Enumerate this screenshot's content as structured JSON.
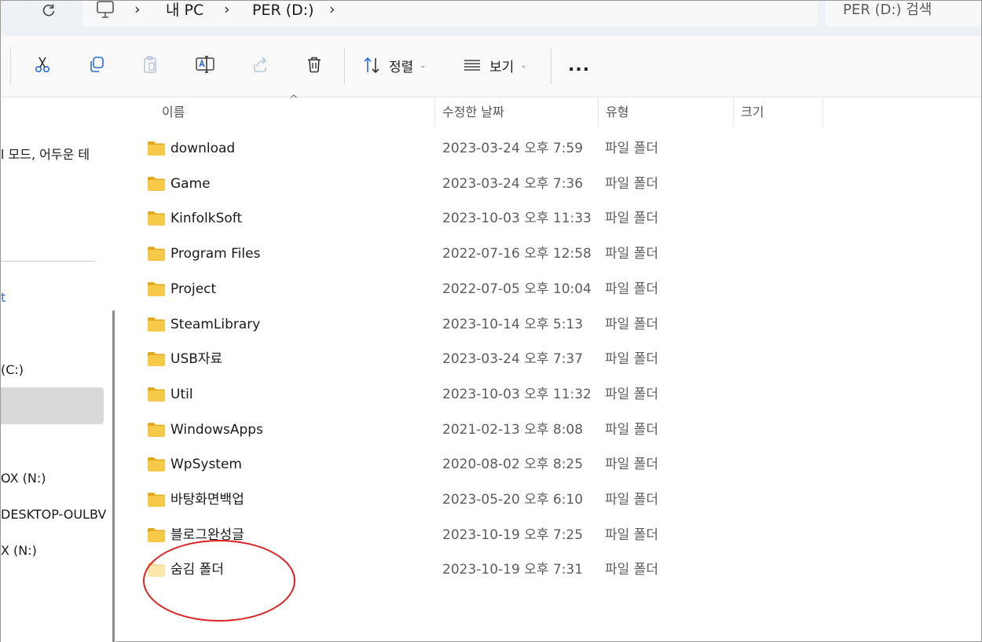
{
  "address": {
    "crumbs": [
      "내 PC",
      "PER (D:)"
    ],
    "search_placeholder": "PER (D:) 검색"
  },
  "toolbar": {
    "sort_label": "정렬",
    "view_label": "보기",
    "more_label": "..."
  },
  "nav": {
    "snippets": [
      {
        "text": "l 모드, 어두운 테"
      },
      {
        "text": "t"
      },
      {
        "text": "(C:)"
      },
      {
        "text": "OX (N:)"
      },
      {
        "text": "DESKTOP-OULBV"
      },
      {
        "text": "X (N:)"
      }
    ]
  },
  "columns": {
    "name": "이름",
    "date": "수정한 날짜",
    "type": "유형",
    "size": "크기"
  },
  "files": [
    {
      "name": "download",
      "date": "2023-03-24 오후 7:59",
      "type": "파일 폴더",
      "hidden": false
    },
    {
      "name": "Game",
      "date": "2023-03-24 오후 7:36",
      "type": "파일 폴더",
      "hidden": false
    },
    {
      "name": "KinfolkSoft",
      "date": "2023-10-03 오후 11:33",
      "type": "파일 폴더",
      "hidden": false
    },
    {
      "name": "Program Files",
      "date": "2022-07-16 오후 12:58",
      "type": "파일 폴더",
      "hidden": false
    },
    {
      "name": "Project",
      "date": "2022-07-05 오후 10:04",
      "type": "파일 폴더",
      "hidden": false
    },
    {
      "name": "SteamLibrary",
      "date": "2023-10-14 오후 5:13",
      "type": "파일 폴더",
      "hidden": false
    },
    {
      "name": "USB자료",
      "date": "2023-03-24 오후 7:37",
      "type": "파일 폴더",
      "hidden": false
    },
    {
      "name": "Util",
      "date": "2023-10-03 오후 11:32",
      "type": "파일 폴더",
      "hidden": false
    },
    {
      "name": "WindowsApps",
      "date": "2021-02-13 오후 8:08",
      "type": "파일 폴더",
      "hidden": false
    },
    {
      "name": "WpSystem",
      "date": "2020-08-02 오후 8:25",
      "type": "파일 폴더",
      "hidden": false
    },
    {
      "name": "바탕화면백업",
      "date": "2023-05-20 오후 6:10",
      "type": "파일 폴더",
      "hidden": false
    },
    {
      "name": "블로그완성글",
      "date": "2023-10-19 오후 7:25",
      "type": "파일 폴더",
      "hidden": false
    },
    {
      "name": "숨김 폴더",
      "date": "2023-10-19 오후 7:31",
      "type": "파일 폴더",
      "hidden": true
    }
  ],
  "colors": {
    "folder": "#f7c948",
    "folder_dark": "#e3a81e",
    "highlight": "#e02020",
    "accent": "#3a6fd8"
  }
}
